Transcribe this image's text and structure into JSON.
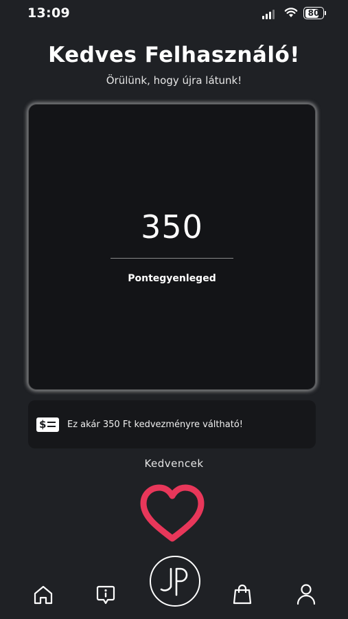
{
  "status_bar": {
    "time": "13:09",
    "battery_level": "80",
    "battery_fraction": 0.8
  },
  "greeting": {
    "title": "Kedves Felhasználó!",
    "subtitle": "Örülünk, hogy újra látunk!"
  },
  "points_card": {
    "value": "350",
    "label": "Pontegyenleged"
  },
  "discount": {
    "icon": "dollar-card-icon",
    "text": "Ez akár 350 Ft kedvezményre váltható!"
  },
  "favorites": {
    "label": "Kedvencek",
    "icon": "heart-icon",
    "heart_color": "#e8375a"
  },
  "bottom_nav": {
    "items": [
      {
        "icon": "home-icon"
      },
      {
        "icon": "info-chat-icon"
      },
      {
        "icon": "jp-logo-icon"
      },
      {
        "icon": "shopping-bag-icon"
      },
      {
        "icon": "profile-icon"
      }
    ]
  },
  "colors": {
    "background": "#1f2125",
    "card": "#131417",
    "accent": "#e8375a"
  }
}
